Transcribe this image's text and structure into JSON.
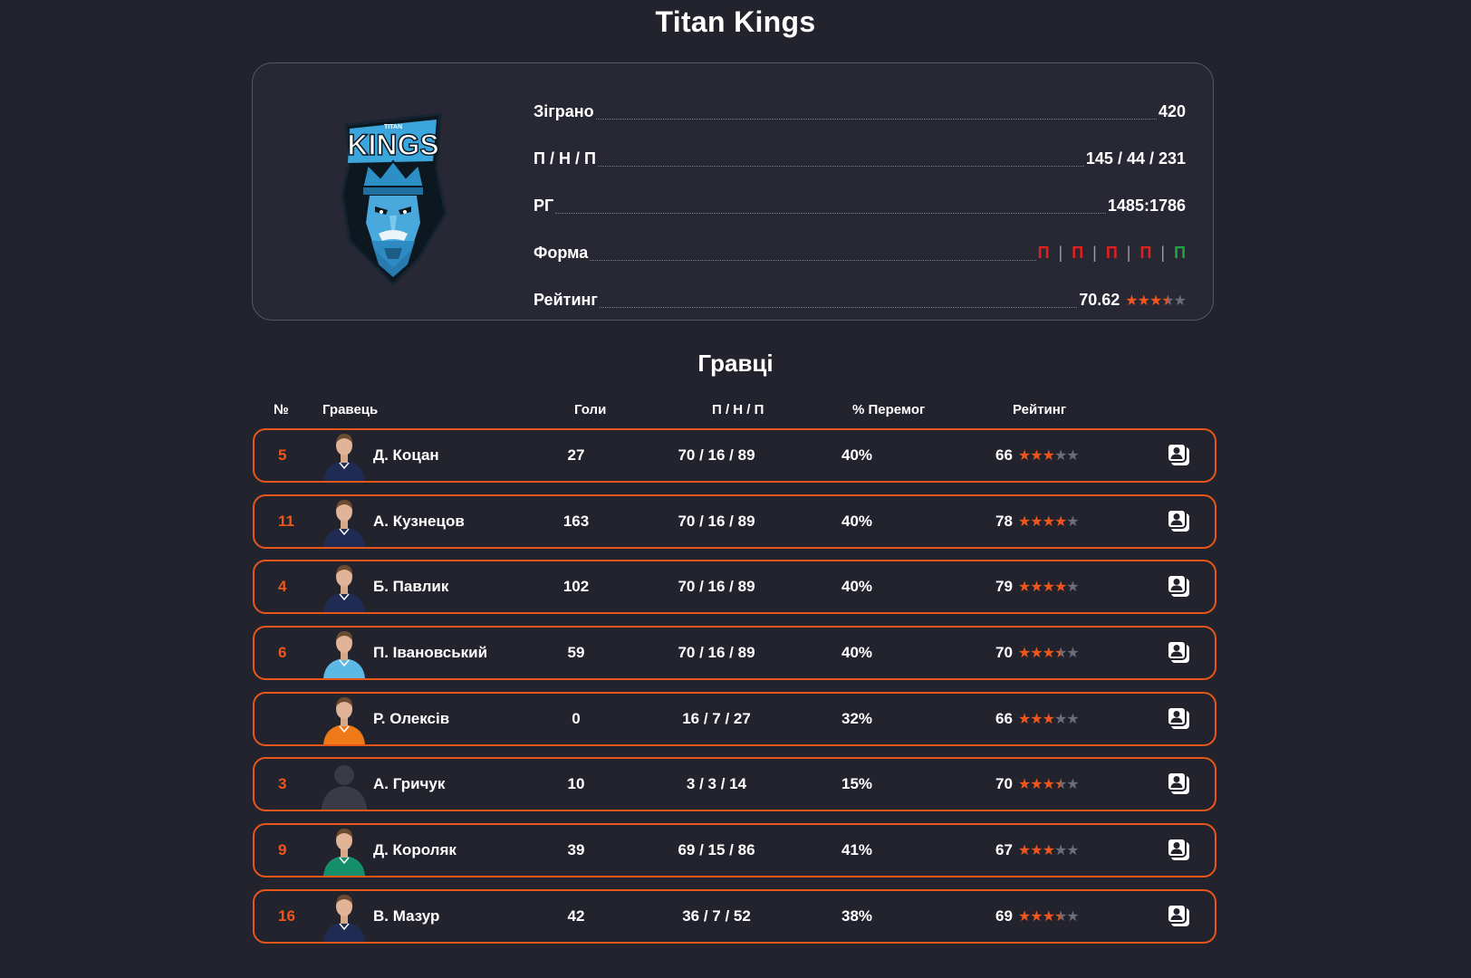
{
  "team": {
    "name": "Titan Kings",
    "logo_text": "KINGS",
    "logo_subtext": "TITAN"
  },
  "stats": {
    "played_label": "Зіграно",
    "played_value": "420",
    "wdl_label": "П / Н / П",
    "wdl_value": "145 / 44 / 231",
    "goals_label": "РГ",
    "goals_value": "1485:1786",
    "form_label": "Форма",
    "form": [
      {
        "letter": "П",
        "color": "#e0201c"
      },
      {
        "letter": "П",
        "color": "#e0201c"
      },
      {
        "letter": "П",
        "color": "#e0201c"
      },
      {
        "letter": "П",
        "color": "#e0201c"
      },
      {
        "letter": "П",
        "color": "#1fa640"
      }
    ],
    "form_separator": "|",
    "rating_label": "Рейтинг",
    "rating_value": "70.62",
    "rating_stars": 3.5
  },
  "players_section": {
    "title": "Гравці",
    "columns": {
      "number": "№",
      "player": "Гравець",
      "goals": "Голи",
      "wdl": "П / Н / П",
      "win_pct": "% Перемог",
      "rating": "Рейтинг"
    },
    "players": [
      {
        "number": "5",
        "name": "Д. Коцан",
        "goals": "27",
        "wdl": "70 / 16 / 89",
        "win_pct": "40%",
        "rating": "66",
        "stars": 3.0,
        "kit": "#1f2b52",
        "avatar": "photo"
      },
      {
        "number": "11",
        "name": "А. Кузнецов",
        "goals": "163",
        "wdl": "70 / 16 / 89",
        "win_pct": "40%",
        "rating": "78",
        "stars": 4.0,
        "kit": "#1f2b52",
        "avatar": "photo"
      },
      {
        "number": "4",
        "name": "Б. Павлик",
        "goals": "102",
        "wdl": "70 / 16 / 89",
        "win_pct": "40%",
        "rating": "79",
        "stars": 4.0,
        "kit": "#1f2b52",
        "avatar": "photo"
      },
      {
        "number": "6",
        "name": "П. Івановський",
        "goals": "59",
        "wdl": "70 / 16 / 89",
        "win_pct": "40%",
        "rating": "70",
        "stars": 3.5,
        "kit": "#5bb9e3",
        "avatar": "photo"
      },
      {
        "number": "",
        "name": "Р. Олексів",
        "goals": "0",
        "wdl": "16 / 7 / 27",
        "win_pct": "32%",
        "rating": "66",
        "stars": 3.0,
        "kit": "#ee7a1a",
        "avatar": "photo"
      },
      {
        "number": "3",
        "name": "А. Гричук",
        "goals": "10",
        "wdl": "3 / 3 / 14",
        "win_pct": "15%",
        "rating": "70",
        "stars": 3.5,
        "kit": "#30313b",
        "avatar": "silhouette"
      },
      {
        "number": "9",
        "name": "Д. Короляк",
        "goals": "39",
        "wdl": "69 / 15 / 86",
        "win_pct": "41%",
        "rating": "67",
        "stars": 3.0,
        "kit": "#148f6a",
        "avatar": "photo"
      },
      {
        "number": "16",
        "name": "В. Мазур",
        "goals": "42",
        "wdl": "36 / 7 / 52",
        "win_pct": "38%",
        "rating": "69",
        "stars": 3.5,
        "kit": "#1f2b52",
        "avatar": "photo"
      }
    ]
  },
  "icons": {
    "player_card": "player-card-icon",
    "star": "star-icon"
  },
  "colors": {
    "accent": "#f0561c",
    "star_empty": "#6b6d7b",
    "background": "#22232d",
    "card_border": "#56586a",
    "row_border": "#e8571a"
  }
}
